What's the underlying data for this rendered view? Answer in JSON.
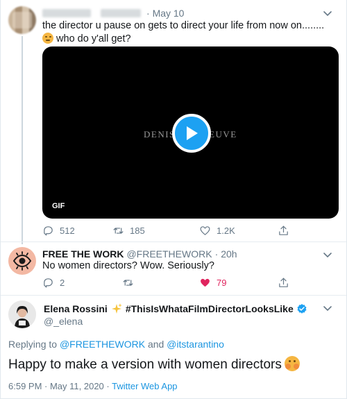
{
  "tweet1": {
    "date": "May 10",
    "text_before_emoji": "the director u pause on gets to direct your life from now on........",
    "emoji": "face-with-hand-over-mouth-emoji",
    "text_after_emoji": "who do y'all get?",
    "media": {
      "title_left": "DENIS",
      "title_right": "EUVE",
      "badge": "GIF"
    },
    "actions": {
      "replies": "512",
      "retweets": "185",
      "likes": "1.2K"
    }
  },
  "tweet2": {
    "name": "FREE THE WORK",
    "handle": "@FREETHEWORK",
    "separator": "·",
    "time": "20h",
    "text": "No women directors? Wow. Seriously?",
    "actions": {
      "replies": "2",
      "retweets": "",
      "likes": "79"
    },
    "like_color": "#e0245e"
  },
  "tweet3": {
    "name": "Elena Rossini",
    "name_suffix": "#ThisIsWhataFilmDirectorLooksLike",
    "handle": "@_elena",
    "replying_prefix": "Replying to",
    "replying_user1": "@FREETHEWORK",
    "replying_and": "and",
    "replying_user2": "@itstarantino",
    "text": "Happy to make a version with women directors",
    "timestamp": "6:59 PM · May 11, 2020 ·",
    "source": "Twitter Web App"
  },
  "colors": {
    "accent": "#1da1f2",
    "link": "#1b95e0",
    "secondary_text": "#657786",
    "like_red": "#e0245e",
    "verified": "#1da1f2"
  }
}
